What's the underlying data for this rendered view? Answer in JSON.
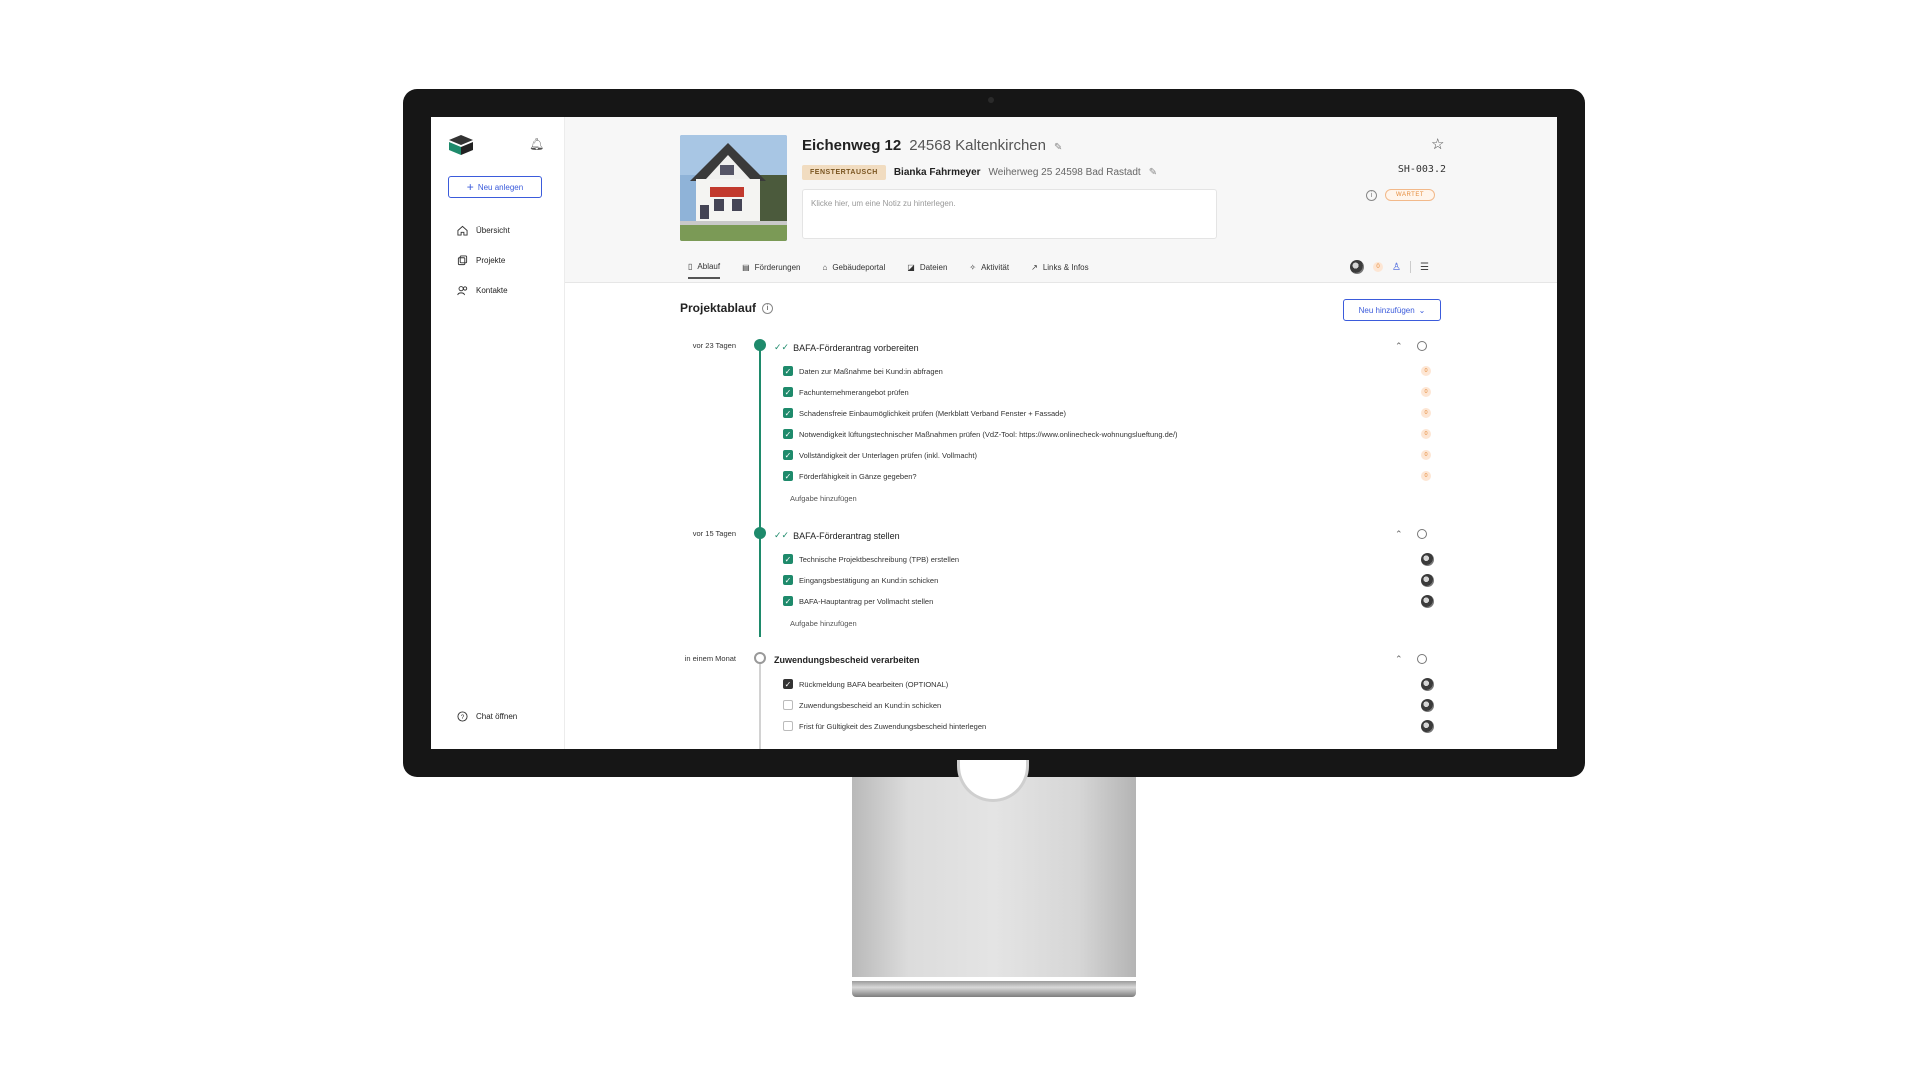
{
  "sidebar": {
    "new_button": "Neu anlegen",
    "nav": [
      {
        "label": "Übersicht",
        "icon": "home-icon"
      },
      {
        "label": "Projekte",
        "icon": "projects-icon"
      },
      {
        "label": "Kontakte",
        "icon": "contacts-icon"
      }
    ],
    "chat": "Chat öffnen"
  },
  "header": {
    "street": "Eichenweg 12",
    "city": "24568 Kaltenkirchen",
    "tag": "FENSTERTAUSCH",
    "owner": "Bianka Fahrmeyer",
    "owner_address": "Weiherweg 25 24598 Bad Rastadt",
    "note_placeholder": "Klicke hier, um eine Notiz zu hinterlegen.",
    "project_code": "SH-003.2",
    "status": "WARTET"
  },
  "tabs": [
    "Ablauf",
    "Förderungen",
    "Gebäudeportal",
    "Dateien",
    "Aktivität",
    "Links & Infos"
  ],
  "tab_tools": {
    "badge": "0"
  },
  "main": {
    "title": "Projektablauf",
    "add_button": "Neu hinzufügen",
    "add_task": "Aufgabe hinzufügen",
    "phases": [
      {
        "when": "vor 23 Tagen",
        "title": "BAFA-Förderantrag vorbereiten",
        "tasks": [
          "Daten zur Maßnahme bei Kund:in abfragen",
          "Fachunternehmerangebot prüfen",
          "Schadensfreie Einbaumöglichkeit prüfen (Merkblatt Verband Fenster + Fassade)",
          "Notwendigkeit lüftungstechnischer Maßnahmen prüfen (VdZ-Tool: https://www.onlinecheck-wohnungslueftung.de/)",
          "Vollständigkeit der Unterlagen prüfen (inkl. Vollmacht)",
          "Förderfähigkeit in Gänze gegeben?"
        ],
        "task_badge": "0"
      },
      {
        "when": "vor 15 Tagen",
        "title": "BAFA-Förderantrag stellen",
        "tasks": [
          "Technische Projektbeschreibung (TPB) erstellen",
          "Eingangsbestätigung an Kund:in schicken",
          "BAFA-Hauptantrag per Vollmacht stellen"
        ]
      },
      {
        "when": "in einem Monat",
        "title": "Zuwendungsbescheid verarbeiten",
        "tasks": [
          "Rückmeldung BAFA bearbeiten (OPTIONAL)",
          "Zuwendungsbescheid an Kund:in schicken",
          "Frist für Gültigkeit des Zuwendungsbescheid hinterlegen"
        ]
      }
    ]
  },
  "colors": {
    "accent": "#1e8a6b",
    "link": "#3b5bdb",
    "status": "#e58b3a"
  }
}
